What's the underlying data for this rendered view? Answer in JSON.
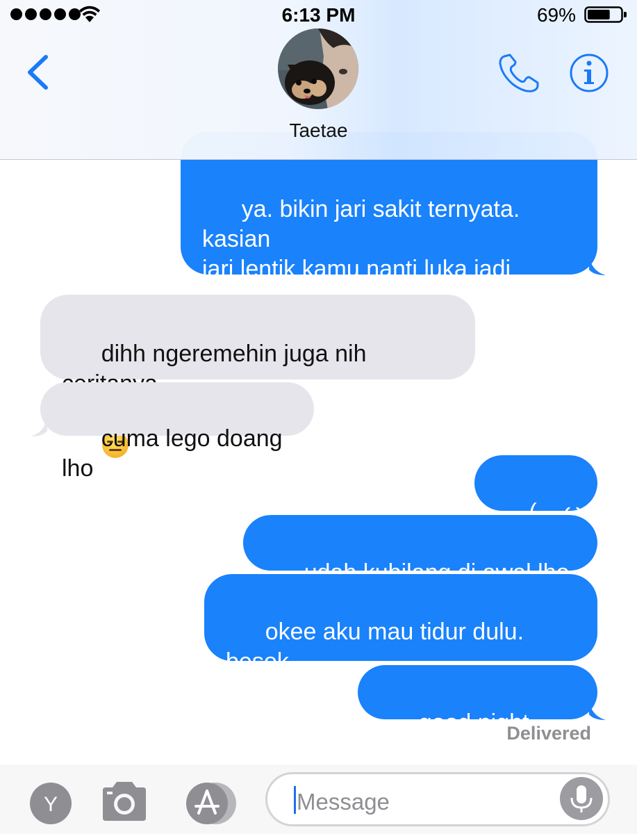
{
  "status_bar": {
    "time": "6:13 PM",
    "battery_percent": "69%",
    "battery_level": 0.69,
    "signal_bars": 5
  },
  "header": {
    "contact_name": "Taetae",
    "back_icon": "chevron-left-icon",
    "call_icon": "phone-icon",
    "info_icon": "info-icon"
  },
  "messages": [
    {
      "direction": "out",
      "text": "ya. bikin jari sakit ternyata. kasian\njari lentik kamu nanti luka jadi\nnggak cantik lagi"
    },
    {
      "direction": "in",
      "text": "dihh ngeremehin juga nih ceritanya",
      "emoji": "expressionless-face-emoji"
    },
    {
      "direction": "in",
      "text": "cuma lego doang lho"
    },
    {
      "direction": "out",
      "text": "(◡ ω ◡)"
    },
    {
      "direction": "out",
      "text": "udah kubilang di awal lho ya"
    },
    {
      "direction": "out",
      "text": "okee aku mau tidur dulu. besok\nsibukkk dari pagi sampe sore"
    },
    {
      "direction": "out",
      "text": "good night taetae"
    }
  ],
  "delivered_label": "Delivered",
  "composer": {
    "placeholder": "Message",
    "apps_label": "Y",
    "camera_icon": "camera-icon",
    "appstore_icon": "app-store-icon",
    "mic_icon": "microphone-icon"
  },
  "colors": {
    "accent": "#1a82fb",
    "incoming_bubble": "#e6e5eb",
    "icon_gray": "#8e8e93"
  }
}
